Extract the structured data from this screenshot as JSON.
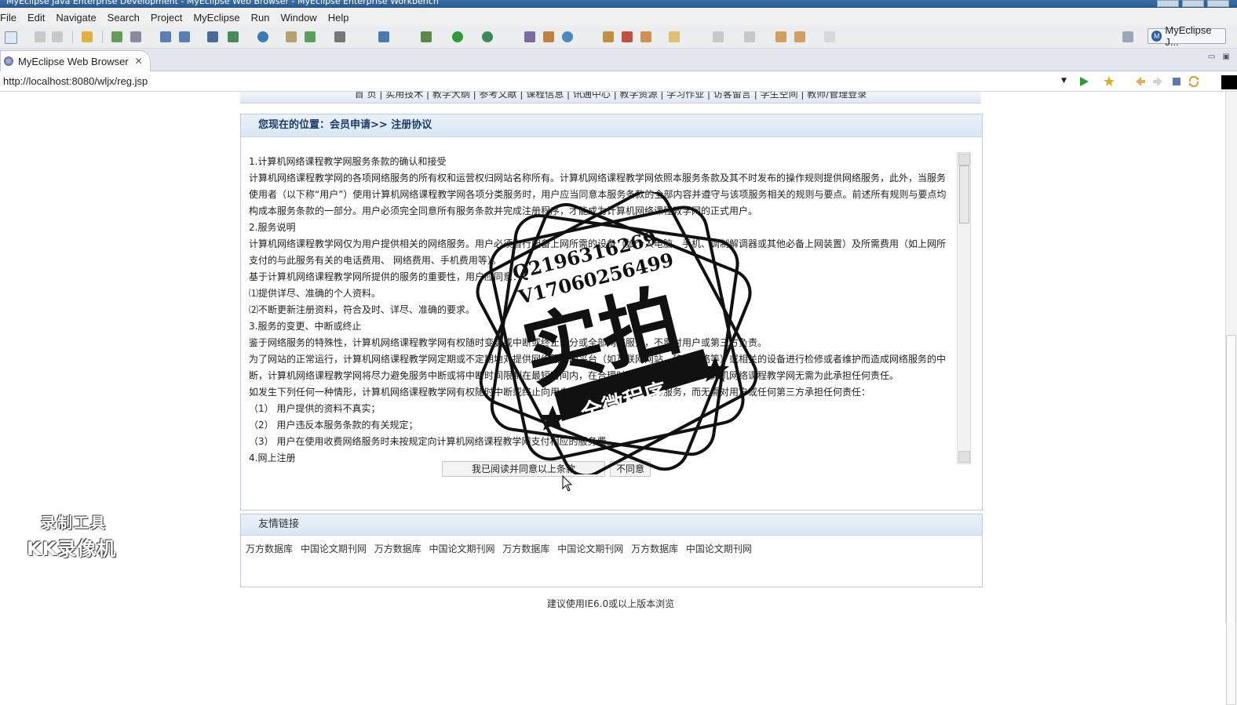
{
  "window": {
    "title": "MyEclipse Java Enterprise Development - MyEclipse Web Browser - MyEclipse Enterprise Workbench"
  },
  "menu": [
    "File",
    "Edit",
    "Navigate",
    "Search",
    "Project",
    "MyEclipse",
    "Run",
    "Window",
    "Help"
  ],
  "perspective": {
    "label": "MyEclipse J...",
    "icon": "myeclipse-perspective-icon"
  },
  "editor_tab": {
    "label": "MyEclipse Web Browser",
    "close": "✕"
  },
  "browser": {
    "url": "http://localhost:8080/wljx/reg.jsp"
  },
  "page": {
    "nav_text": "首 页 | 实用技术 | 教学大纲 | 参考文献 | 课程信息 | 讯通中心 | 教学资源 | 学习作业 | 访客留言 | 学生空间 | 教师/管理登录",
    "location": "您现在的位置：会员申请>> 注册协议",
    "terms": [
      "1.计算机网络课程教学网服务条款的确认和接受",
      "计算机网络课程教学网的各项网络服务的所有权和运营权归网站名称所有。计算机网络课程教学网依照本服务条款及其不时发布的操作规则提供网络服务，此外，当服务使用者（以下称“用户”）使用计算机网络课程教学网各项分类服务时，用户应当同意本服务条款的全部内容并遵守与该项服务相关的规则与要点。前述所有规则与要点均构成本服务条款的一部分。用户必须完全同意所有服务条款并完成注册程序，才能成为计算机网络课程教学网的正式用户。",
      "2.服务说明",
      "计算机网络课程教学网仅为用户提供相关的网络服务。用户必须自行配备上网所需的设备（如个人电脑、手机、调制解调器或其他必备上网装置）及所需费用（如上网所支付的与此服务有关的电话费用、 网络费用、手机费用等）。",
      "基于计算机网络课程教学网所提供的服务的重要性，用户应同意：",
      "⑴提供详尽、准确的个人资料。",
      "⑵不断更新注册资料，符合及时、详尽、准确的要求。",
      "3.服务的变更、中断或终止",
      "鉴于网络服务的特殊性，计算机网络课程教学网有权随时变更或中断或终止部分或全部网络服务，不需对用户或第三方负责。",
      "为了网站的正常运行，计算机网络课程教学网定期或不定期地对提供网络服务的平台（如互联网网站、移动网络等）或相关的设备进行检修或者维护而造成网络服务的中断，计算机网络课程教学网将尽力避免服务中断或将中断时间限制在最短时间内，在合理时间内的服务中断，计算机网络课程教学网无需为此承担任何责任。",
      "如发生下列任何一种情形，计算机网络课程教学网有权随时中断或终止向用户提供本协议项下的网络服务，而无需对用户或任何第三方承担任何责任：",
      "（1） 用户提供的资料不真实；",
      "（2） 用户违反本服务条款的有关规定；",
      "（3） 用户在使用收费网络服务时未按规定向计算机网络课程教学网支付相应的服务费。",
      "4.网上注册"
    ],
    "agree_button": "我已阅读并同意以上条款",
    "disagree_button": "不同意",
    "links_title": "友情链接",
    "links": [
      "万方数据库",
      "中国论文期刊网",
      "万方数据库",
      "中国论文期刊网",
      "万方数据库",
      "中国论文期刊网",
      "万方数据库",
      "中国论文期刊网"
    ],
    "footer": "建议使用IE6.0或以上版本浏览"
  },
  "overlay": {
    "stamp_line1": "Q2196316269",
    "stamp_line2": "V17060256499",
    "stamp_big": "实拍",
    "stamp_banner": "全微程序",
    "recorder_line1": "录制工具",
    "recorder_line2": "KK录像机"
  }
}
